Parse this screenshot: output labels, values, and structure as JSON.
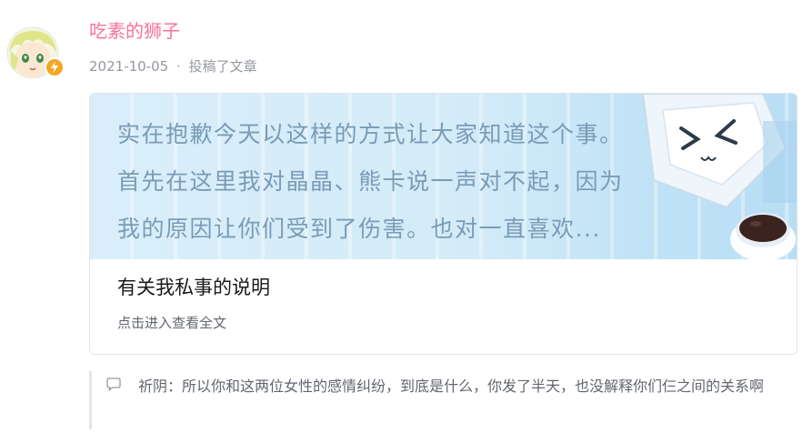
{
  "author": {
    "name": "吃素的狮子",
    "date": "2021-10-05",
    "action": "投稿了文章",
    "separator": "·"
  },
  "article": {
    "banner_lines": [
      "实在抱歉今天以这样的方式让大家知道这个事。",
      "首先在这里我对晶晶、熊卡说一声对不起，因为",
      "我的原因让你们受到了伤害。也对一直喜欢..."
    ],
    "title": "有关我私事的说明",
    "link_text": "点击进入查看全文"
  },
  "comment": {
    "icon": "speech-bubble-icon",
    "author": "祈阴：",
    "text": "所以你和这两位女性的感情纠纷，到底是什么，你发了半天，也没解释你们仨之间的关系啊"
  },
  "colors": {
    "author_name": "#fb7299",
    "meta_text": "#9499a0",
    "banner_text": "#7a9bb6",
    "title_text": "#18191c",
    "secondary_text": "#61666d",
    "badge": "#f5a623"
  }
}
